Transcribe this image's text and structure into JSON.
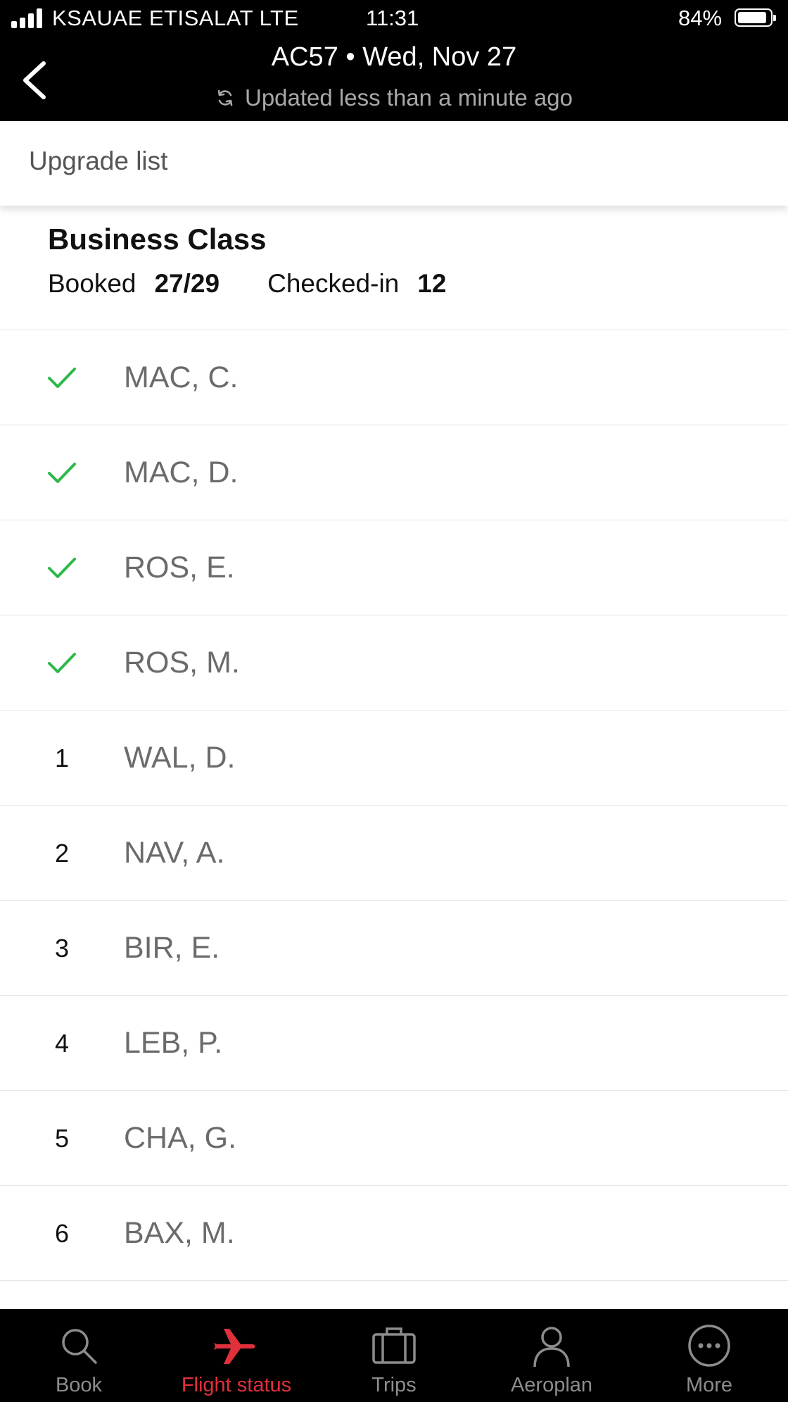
{
  "status_bar": {
    "carrier": "KSAUAE ETISALAT  LTE",
    "time": "11:31",
    "battery": "84%",
    "battery_level": 0.84
  },
  "header": {
    "title": "AC57 • Wed, Nov 27",
    "updated": "Updated less than a minute ago"
  },
  "subheader": {
    "label": "Upgrade list"
  },
  "summary": {
    "class_name": "Business Class",
    "booked_label": "Booked",
    "booked_value": "27/29",
    "checked_in_label": "Checked-in",
    "checked_in_value": "12"
  },
  "passengers": [
    {
      "marker": "check",
      "name": "MAC, C."
    },
    {
      "marker": "check",
      "name": "MAC, D."
    },
    {
      "marker": "check",
      "name": "ROS, E."
    },
    {
      "marker": "check",
      "name": "ROS, M."
    },
    {
      "marker": "1",
      "name": "WAL, D."
    },
    {
      "marker": "2",
      "name": "NAV, A."
    },
    {
      "marker": "3",
      "name": "BIR, E."
    },
    {
      "marker": "4",
      "name": "LEB, P."
    },
    {
      "marker": "5",
      "name": "CHA, G."
    },
    {
      "marker": "6",
      "name": "BAX, M."
    }
  ],
  "tabs": [
    {
      "label": "Book",
      "icon": "search-icon",
      "active": false
    },
    {
      "label": "Flight status",
      "icon": "airplane-icon",
      "active": true
    },
    {
      "label": "Trips",
      "icon": "briefcase-icon",
      "active": false
    },
    {
      "label": "Aeroplan",
      "icon": "person-icon",
      "active": false
    },
    {
      "label": "More",
      "icon": "more-icon",
      "active": false
    }
  ],
  "colors": {
    "accent": "#e0303b",
    "check": "#2db84a",
    "header_bg": "#000000"
  }
}
